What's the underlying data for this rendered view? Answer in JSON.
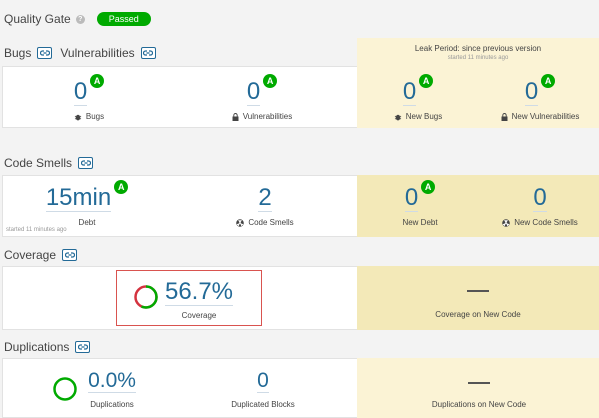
{
  "quality_gate": {
    "label": "Quality Gate",
    "help_icon": "?",
    "status": "Passed"
  },
  "bugs_section": {
    "title": "Bugs",
    "vulnerabilities_title": "Vulnerabilities",
    "leak_header": {
      "title": "Leak Period: since previous version",
      "subtitle": "started 11 minutes ago"
    },
    "bugs": {
      "value": "0",
      "rating": "A",
      "label": "Bugs",
      "icon": "bug-icon"
    },
    "vulnerabilities": {
      "value": "0",
      "rating": "A",
      "label": "Vulnerabilities",
      "icon": "lock-icon"
    },
    "new_bugs": {
      "value": "0",
      "rating": "A",
      "label": "New Bugs",
      "icon": "bug-icon"
    },
    "new_vulnerabilities": {
      "value": "0",
      "rating": "A",
      "label": "New Vulnerabilities",
      "icon": "lock-icon"
    }
  },
  "code_smells_section": {
    "title": "Code Smells",
    "debt": {
      "value": "15min",
      "rating": "A",
      "label": "Debt"
    },
    "started": "started 11 minutes ago",
    "code_smells": {
      "value": "2",
      "label": "Code Smells",
      "icon": "radiation-icon"
    },
    "new_debt": {
      "value": "0",
      "rating": "A",
      "label": "New Debt"
    },
    "new_code_smells": {
      "value": "0",
      "label": "New Code Smells",
      "icon": "radiation-icon"
    }
  },
  "coverage_section": {
    "title": "Coverage",
    "coverage": {
      "value": "56.7%",
      "label": "Coverage",
      "percent": 56.7
    },
    "coverage_new": {
      "value": "—",
      "label": "Coverage on New Code"
    }
  },
  "duplications_section": {
    "title": "Duplications",
    "duplications": {
      "value": "0.0%",
      "label": "Duplications",
      "percent": 0
    },
    "duplicated_blocks": {
      "value": "0",
      "label": "Duplicated Blocks"
    },
    "duplications_new": {
      "value": "—",
      "label": "Duplications on New Code"
    }
  },
  "colors": {
    "accent_blue": "#236a97",
    "rating_green": "#00aa00",
    "leak_background": "#fbf3d5",
    "highlight_border": "#d9534f",
    "coverage_red": "#d4333f"
  }
}
